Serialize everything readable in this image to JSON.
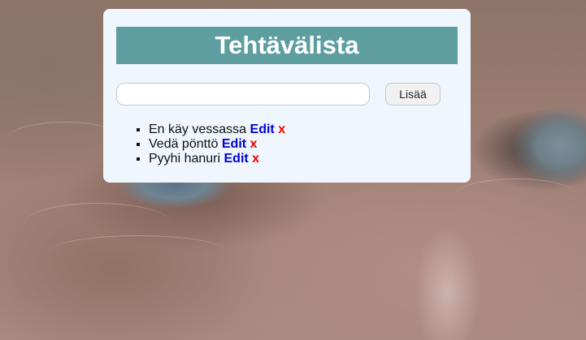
{
  "app": {
    "title": "Tehtävälista"
  },
  "form": {
    "input_value": "",
    "input_placeholder": "",
    "add_label": "Lisää"
  },
  "tasks": [
    {
      "text": "En käy vessassa",
      "edit_label": "Edit",
      "delete_label": "x"
    },
    {
      "text": "Vedä pönttö",
      "edit_label": "Edit",
      "delete_label": "x"
    },
    {
      "text": "Pyyhi hanuri",
      "edit_label": "Edit",
      "delete_label": "x"
    }
  ],
  "colors": {
    "card_background": "#eff6fd",
    "title_background": "#5f9ea0",
    "title_text": "#ffffff",
    "edit_link": "#0000d6",
    "delete_link": "#ee0000"
  }
}
